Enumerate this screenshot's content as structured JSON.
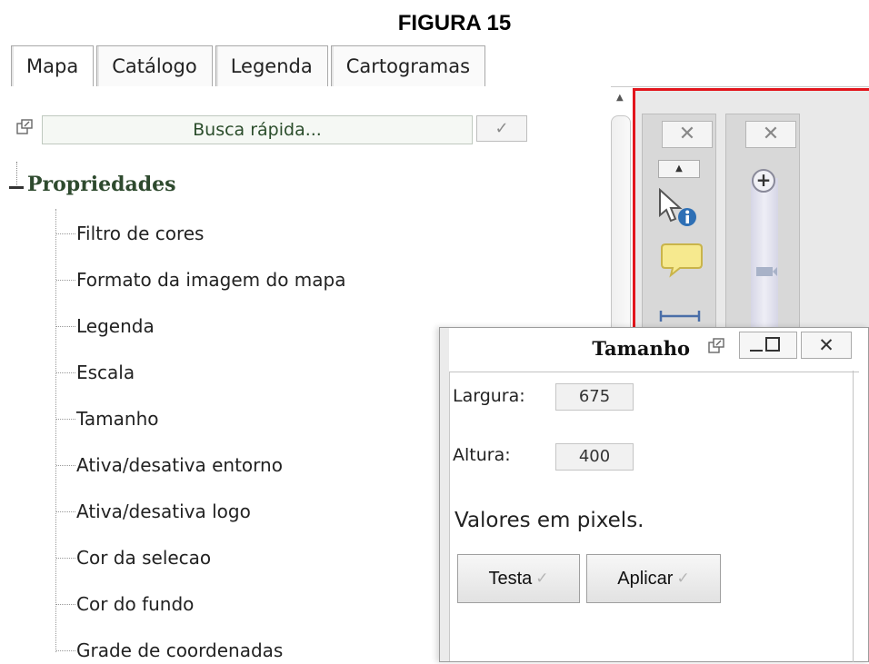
{
  "figure_title": "FIGURA 15",
  "tabs": [
    {
      "label": "Mapa"
    },
    {
      "label": "Catálogo"
    },
    {
      "label": "Legenda"
    },
    {
      "label": "Cartogramas"
    }
  ],
  "search": {
    "placeholder": "Busca rápida...",
    "button_glyph": "✓",
    "popout_icon": "external-window-icon"
  },
  "tree": {
    "root_label": "Propriedades",
    "items": [
      "Filtro de cores",
      "Formato da imagem do mapa",
      "Legenda",
      "Escala",
      "Tamanho",
      "Ativa/desativa entorno",
      "Ativa/desativa logo",
      "Cor da selecao",
      "Cor do fundo",
      "Grade de coordenadas"
    ]
  },
  "map": {
    "border_color": "#e2151c",
    "toolbar_close_glyph": "✕",
    "zoom_in_glyph": "+"
  },
  "dialog": {
    "title": "Tamanho",
    "close_glyph": "✕",
    "width_label": "Largura:",
    "width_value": "675",
    "height_label": "Altura:",
    "height_value": "400",
    "units_note": "Valores em pixels.",
    "test_button": "Testa",
    "apply_button": "Aplicar",
    "check_glyph": "✓"
  },
  "colors": {
    "tree_root": "#2e4a2e",
    "search_text": "#2b4d2b"
  }
}
